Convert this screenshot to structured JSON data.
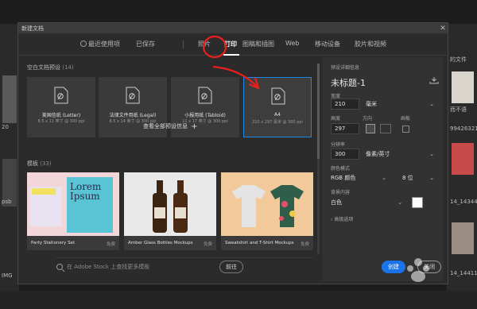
{
  "background": {
    "left_labels": [
      "20",
      "psb",
      "IMG"
    ],
    "right_labels": [
      "的文件",
      "而不语",
      "99426321082",
      "14_143442",
      "14_144115"
    ]
  },
  "dialog": {
    "title": "新建文档",
    "tabs": [
      {
        "label": "最近使用项"
      },
      {
        "label": "已保存"
      },
      {
        "label": "照片"
      },
      {
        "label": "打印"
      },
      {
        "label": "图稿和插图"
      },
      {
        "label": "Web"
      },
      {
        "label": "移动设备"
      },
      {
        "label": "胶片和视频"
      }
    ],
    "active_tab": "打印",
    "blank_presets_heading": "空白文档预设",
    "blank_presets_count": "(14)",
    "presets": [
      {
        "name": "美国信纸 (Letter)",
        "dims": "8.5 x 11 英寸 @ 300 ppi"
      },
      {
        "name": "法律文件用纸 (Legal)",
        "dims": "8.5 x 14 英寸 @ 300 ppi"
      },
      {
        "name": "小报用纸 (Tabloid)",
        "dims": "11 x 17 英寸 @ 300 ppi"
      },
      {
        "name": "A4",
        "dims": "210 x 297 毫米 @ 300 ppi"
      }
    ],
    "view_all_label": "查看全部预设信息",
    "templates_heading": "模板",
    "templates_count": "(33)",
    "templates": [
      {
        "name": "Party Stationery Set",
        "tag": "免费",
        "thumb_text": "Lorem Ipsum"
      },
      {
        "name": "Amber Glass Bottles Mockups",
        "tag": "免费"
      },
      {
        "name": "Sweatshirt and T-Shirt Mockups",
        "tag": "免费"
      }
    ],
    "search_placeholder": "在 Adobe Stock 上查找更多模板",
    "search_button": "前往",
    "details": {
      "heading": "预设详细信息",
      "doc_title": "未标题-1",
      "width_label": "宽度",
      "width_value": "210",
      "width_unit": "毫米",
      "height_label": "高度",
      "height_value": "297",
      "orientation_label": "方向",
      "artboards_label": "画板",
      "resolution_label": "分辨率",
      "resolution_value": "300",
      "resolution_unit": "像素/英寸",
      "color_mode_label": "颜色模式",
      "color_mode_value": "RGB 颜色",
      "bit_depth": "8 位",
      "background_label": "背景内容",
      "background_value": "白色",
      "advanced_label": "高级选项"
    },
    "create_button": "创建",
    "close_button": "关闭"
  },
  "colors": {
    "accent": "#1b87e6",
    "annotation": "#e8201c"
  }
}
